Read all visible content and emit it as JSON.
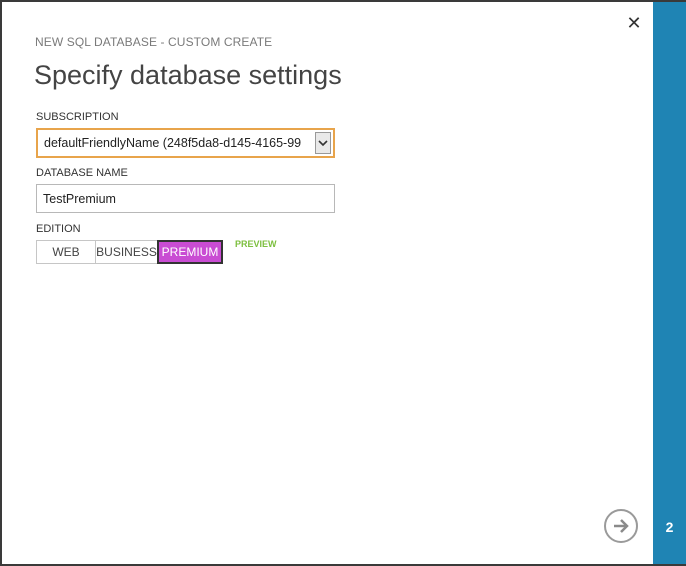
{
  "wizard": {
    "title": "NEW SQL DATABASE - CUSTOM CREATE",
    "page_title": "Specify database settings",
    "step": "2"
  },
  "subscription": {
    "label": "SUBSCRIPTION",
    "value": "defaultFriendlyName (248f5da8-d145-4165-99"
  },
  "database_name": {
    "label": "DATABASE NAME",
    "value": "TestPremium"
  },
  "edition": {
    "label": "EDITION",
    "options": [
      "WEB",
      "BUSINESS",
      "PREMIUM"
    ],
    "selected": "PREMIUM",
    "preview_tag": "PREVIEW"
  },
  "icons": {
    "close": "close-icon",
    "next": "arrow-right-icon",
    "dropdown": "chevron-down-icon"
  },
  "colors": {
    "rail": "#1f84b4",
    "selected_edition": "#c94cd3",
    "select_focus": "#e8a44b",
    "preview": "#7cbf3e"
  }
}
